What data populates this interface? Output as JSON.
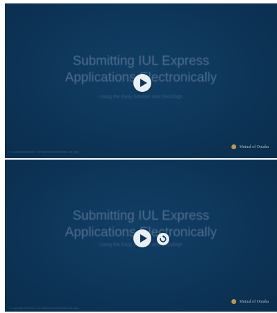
{
  "slides": [
    {
      "title_line1": "Submitting IUL Express",
      "title_line2": "Applications Electronically",
      "subtitle": "Using the Easy Solution and DocuSign",
      "copyright": "© Copyright year info. For financial professional use only.",
      "brand": "Mutual of Omaha"
    },
    {
      "title_line1": "Submitting IUL Express",
      "title_line2": "Applications Electronically",
      "subtitle": "Using the Easy Solution and DocuSign",
      "copyright": "© Copyright year info. For financial professional use only.",
      "brand": "Mutual of Omaha"
    }
  ],
  "icons": {
    "play": "play-icon",
    "replay": "replay-icon",
    "brand": "brand-logo-icon"
  }
}
